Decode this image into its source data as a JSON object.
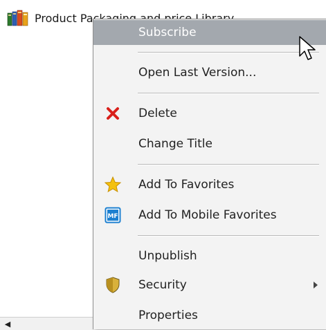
{
  "tree": {
    "item_label": "Product Packaging and price Library",
    "icon": "books-library-icon"
  },
  "context_menu": {
    "items": [
      {
        "label": "Subscribe",
        "icon": null,
        "highlighted": true
      },
      {
        "label": "Open Last Version...",
        "icon": null
      },
      {
        "label": "Delete",
        "icon": "delete-x-icon"
      },
      {
        "label": "Change Title",
        "icon": null
      },
      {
        "label": "Add To Favorites",
        "icon": "star-icon"
      },
      {
        "label": "Add To Mobile Favorites",
        "icon": "mobile-favorites-icon",
        "icon_text": "MF"
      },
      {
        "label": "Unpublish",
        "icon": null
      },
      {
        "label": "Security",
        "icon": "shield-icon",
        "has_submenu": true
      },
      {
        "label": "Properties",
        "icon": null
      }
    ]
  },
  "colors": {
    "highlight": "#a3a8ae",
    "delete_red": "#d9201b",
    "star_yellow": "#f4c10f",
    "mobile_blue": "#1b7fd0"
  }
}
